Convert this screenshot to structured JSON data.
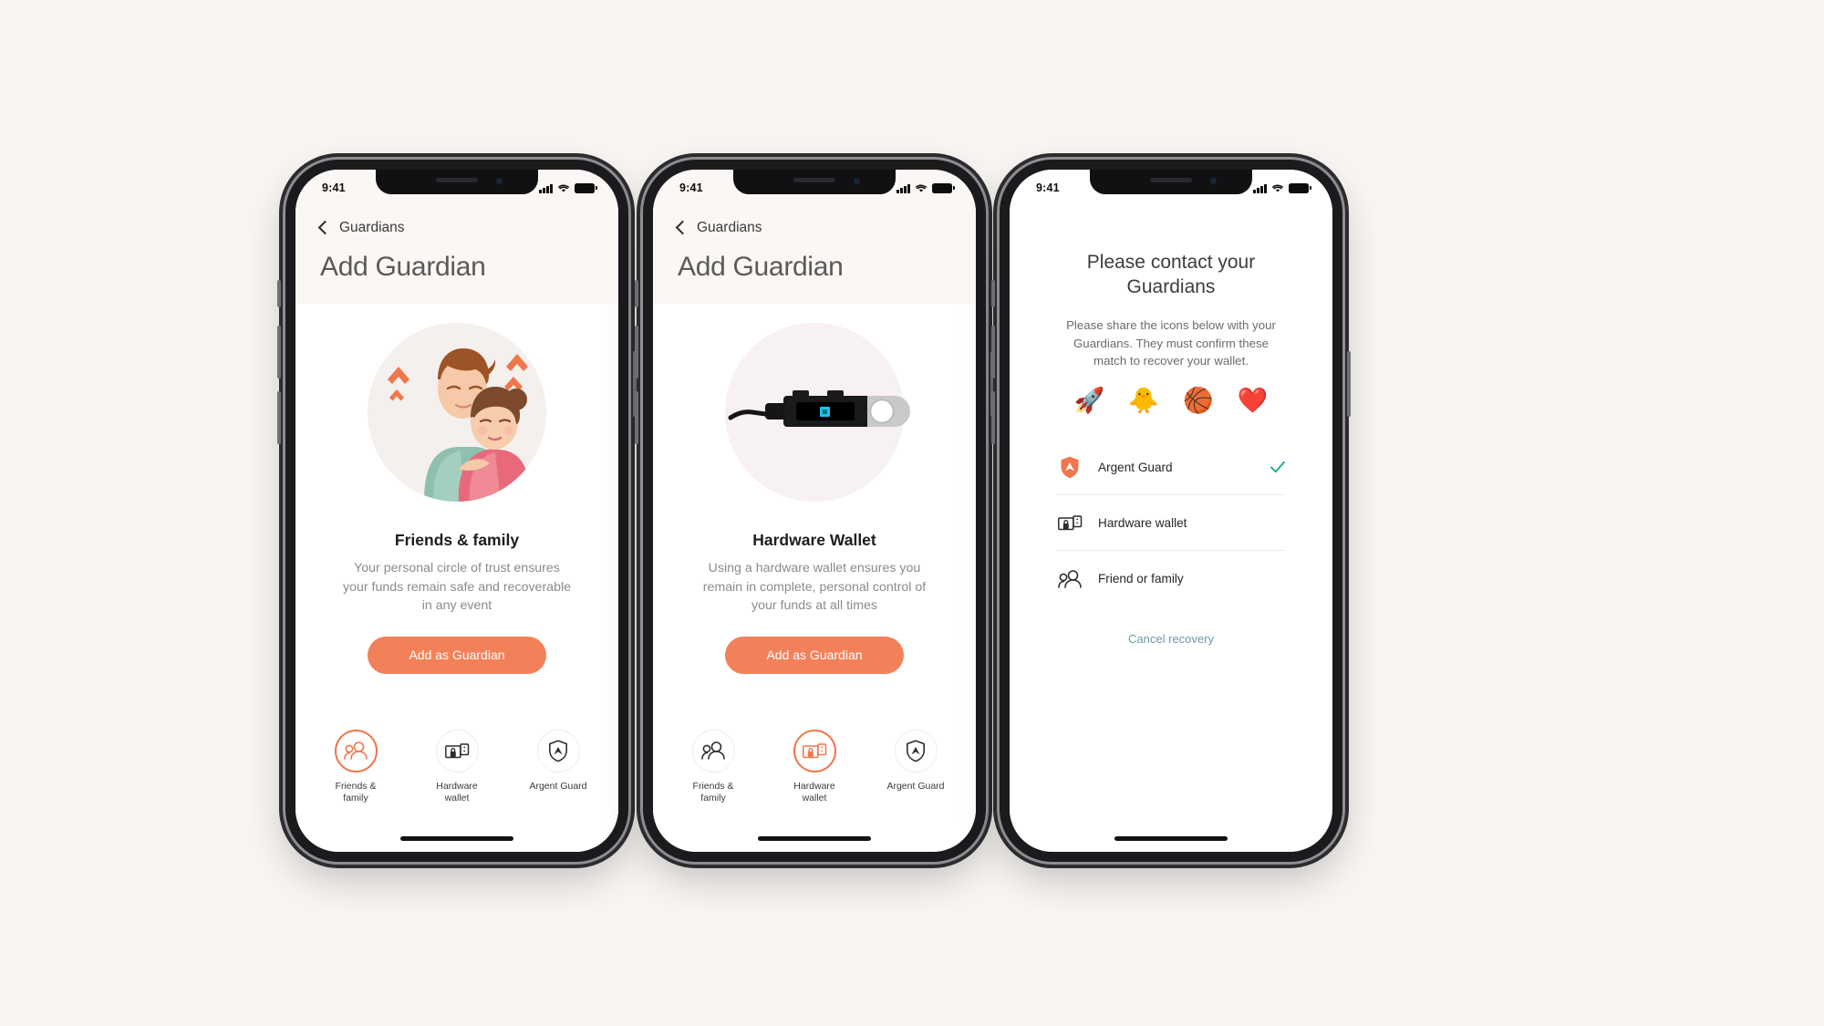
{
  "canvas": {
    "background": "#f8f5f2"
  },
  "theme": {
    "accent": "#f0764b",
    "cta": "#f28159",
    "link": "#6d98a8",
    "check": "#17b07a"
  },
  "status_bar": {
    "time": "9:41",
    "signal": "cellular-bars",
    "wifi": "wifi-icon",
    "battery": "battery-full-icon"
  },
  "phones": [
    {
      "id": "friends-family",
      "header": {
        "back_label": "Guardians",
        "title": "Add Guardian"
      },
      "hero": "friends-family-illustration",
      "card": {
        "title": "Friends & family",
        "description": "Your personal circle of trust ensures your funds remain safe and recoverable in any event"
      },
      "cta_label": "Add as Guardian",
      "tabs": [
        {
          "label": "Friends & family",
          "icon": "people-icon",
          "active": true
        },
        {
          "label": "Hardware wallet",
          "icon": "hardware-wallet-icon",
          "active": false
        },
        {
          "label": "Argent Guard",
          "icon": "shield-icon",
          "active": false
        }
      ]
    },
    {
      "id": "hardware-wallet",
      "header": {
        "back_label": "Guardians",
        "title": "Add Guardian"
      },
      "hero": "ledger-device-illustration",
      "card": {
        "title": "Hardware Wallet",
        "description": "Using a hardware wallet ensures you remain in complete, personal control of your funds at all times"
      },
      "cta_label": "Add as Guardian",
      "tabs": [
        {
          "label": "Friends & family",
          "icon": "people-icon",
          "active": false
        },
        {
          "label": "Hardware wallet",
          "icon": "hardware-wallet-icon",
          "active": true
        },
        {
          "label": "Argent Guard",
          "icon": "shield-icon",
          "active": false
        }
      ]
    },
    {
      "id": "contact-guardians",
      "title": "Please contact your Guardians",
      "description": "Please share the icons below with your Guardians. They must confirm these match to recover your wallet.",
      "emojis": [
        {
          "name": "rocket-emoji",
          "glyph": "🚀"
        },
        {
          "name": "baby-chick-emoji",
          "glyph": "🐥"
        },
        {
          "name": "basketball-emoji",
          "glyph": "🏀"
        },
        {
          "name": "red-heart-emoji",
          "glyph": "❤️"
        }
      ],
      "guardians": [
        {
          "label": "Argent Guard",
          "icon": "argent-shield-icon",
          "confirmed": true
        },
        {
          "label": "Hardware wallet",
          "icon": "hardware-wallet-icon",
          "confirmed": false
        },
        {
          "label": "Friend or family",
          "icon": "people-icon",
          "confirmed": false
        }
      ],
      "cancel_label": "Cancel recovery"
    }
  ]
}
